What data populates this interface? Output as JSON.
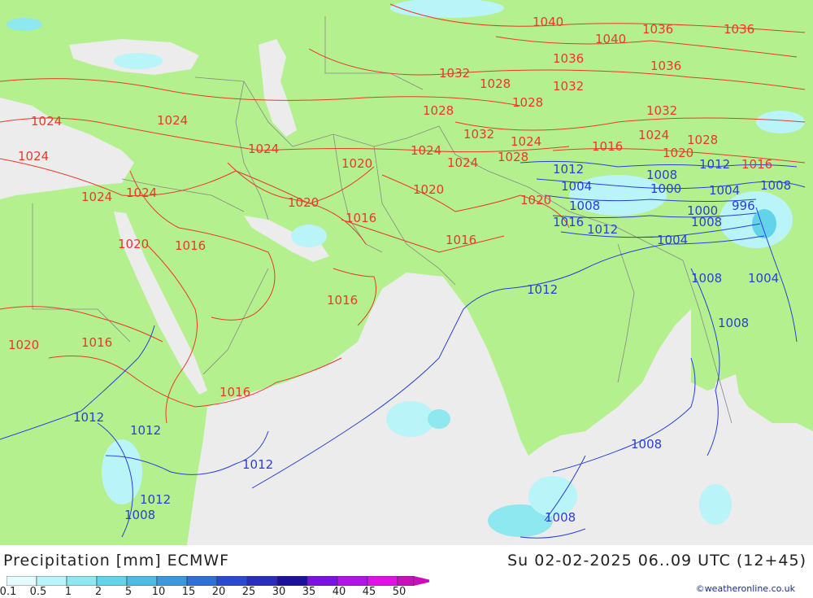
{
  "title": "Precipitation [mm] ECMWF",
  "datetime": "Su 02-02-2025 06..09 UTC (12+45)",
  "credit": "©weatheronline.co.uk",
  "colors": {
    "land": "#b4f08e",
    "sea": "#ececec",
    "high_pressure": "#e8392c",
    "low_pressure": "#2a3fd6"
  },
  "legend": {
    "ticks": [
      "0.1",
      "0.5",
      "1",
      "2",
      "5",
      "10",
      "15",
      "20",
      "25",
      "30",
      "35",
      "40",
      "45",
      "50"
    ],
    "colors": [
      "#e6fbfd",
      "#b9f4f8",
      "#8de8f0",
      "#63d3ea",
      "#4dbbe3",
      "#3b98dc",
      "#2f6fd8",
      "#2b4ad2",
      "#2a2cc0",
      "#1b119c",
      "#7a12e2",
      "#b112e6",
      "#e011e8",
      "#c80fbd"
    ]
  },
  "isobars": {
    "red": [
      {
        "label": "1040"
      },
      {
        "label": "1040"
      },
      {
        "label": "1036"
      },
      {
        "label": "1036"
      },
      {
        "label": "1036"
      },
      {
        "label": "1036"
      },
      {
        "label": "1032"
      },
      {
        "label": "1028"
      },
      {
        "label": "1032"
      },
      {
        "label": "1028"
      },
      {
        "label": "1028"
      },
      {
        "label": "1032"
      },
      {
        "label": "1032"
      },
      {
        "label": "1024"
      },
      {
        "label": "1028"
      },
      {
        "label": "1024"
      },
      {
        "label": "1024"
      },
      {
        "label": "1024"
      },
      {
        "label": "1024"
      },
      {
        "label": "1024"
      },
      {
        "label": "1024"
      },
      {
        "label": "1028"
      },
      {
        "label": "1016"
      },
      {
        "label": "1020"
      },
      {
        "label": "1016"
      },
      {
        "label": "1020"
      },
      {
        "label": "1020"
      },
      {
        "label": "1020"
      },
      {
        "label": "1024"
      },
      {
        "label": "1024"
      },
      {
        "label": "1020"
      },
      {
        "label": "1024"
      },
      {
        "label": "1016"
      },
      {
        "label": "1016"
      },
      {
        "label": "1020"
      },
      {
        "label": "1016"
      },
      {
        "label": "1020"
      },
      {
        "label": "1016"
      },
      {
        "label": "1016"
      },
      {
        "label": "1016"
      }
    ],
    "blue": [
      {
        "label": "1012"
      },
      {
        "label": "1008"
      },
      {
        "label": "1012"
      },
      {
        "label": "1016"
      },
      {
        "label": "1004"
      },
      {
        "label": "1000"
      },
      {
        "label": "1004"
      },
      {
        "label": "1008"
      },
      {
        "label": "1008"
      },
      {
        "label": "996"
      },
      {
        "label": "1000"
      },
      {
        "label": "1008"
      },
      {
        "label": "1012"
      },
      {
        "label": "1004"
      },
      {
        "label": "1012"
      },
      {
        "label": "1008"
      },
      {
        "label": "1004"
      },
      {
        "label": "1008"
      },
      {
        "label": "1008"
      },
      {
        "label": "1012"
      },
      {
        "label": "1012"
      },
      {
        "label": "1012"
      },
      {
        "label": "1012"
      },
      {
        "label": "1008"
      },
      {
        "label": "1008"
      }
    ]
  }
}
